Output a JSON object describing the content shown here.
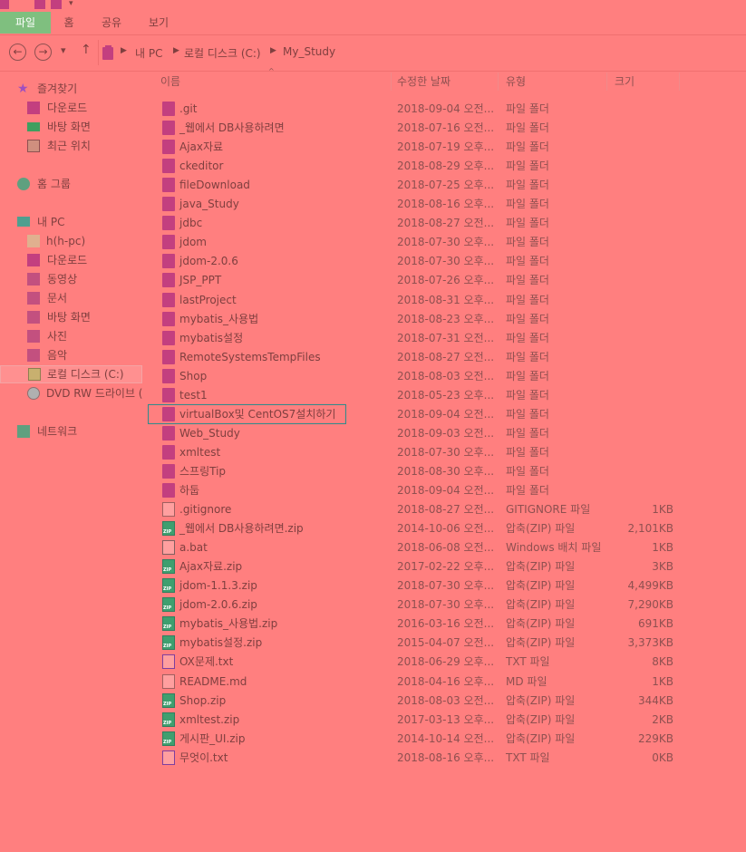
{
  "colors": {
    "background": "#ff7f7f",
    "text": "#7f3f3f",
    "active_tab_bg": "#7fbf7f",
    "folder_icon": "#c33f7f",
    "zip_icon": "#3f9f6f",
    "focus_border": "#2e8b8b"
  },
  "ribbon": {
    "tabs": [
      "파일",
      "홈",
      "공유",
      "보기"
    ]
  },
  "address": {
    "back": "←",
    "forward": "→",
    "recent": "▾",
    "up": "↑",
    "crumbs": [
      "내 PC",
      "로컬 디스크 (C:)",
      "My_Study"
    ]
  },
  "nav": {
    "items": [
      {
        "label": "즐겨찾기",
        "icon": "star-icon"
      },
      {
        "label": "다운로드",
        "icon": "download-folder-icon"
      },
      {
        "label": "바탕 화면",
        "icon": "desktop-icon"
      },
      {
        "label": "최근 위치",
        "icon": "recent-places-icon"
      },
      {
        "label": "홈 그룹",
        "icon": "homegroup-icon"
      },
      {
        "label": "내 PC",
        "icon": "computer-icon"
      },
      {
        "label": "h(h-pc)",
        "icon": "user-folder-icon"
      },
      {
        "label": "다운로드",
        "icon": "download-folder-icon"
      },
      {
        "label": "동영상",
        "icon": "videos-folder-icon"
      },
      {
        "label": "문서",
        "icon": "documents-folder-icon"
      },
      {
        "label": "바탕 화면",
        "icon": "desktop-folder-icon"
      },
      {
        "label": "사진",
        "icon": "pictures-folder-icon"
      },
      {
        "label": "음악",
        "icon": "music-folder-icon"
      },
      {
        "label": "로컬 디스크 (C:)",
        "icon": "local-disk-icon"
      },
      {
        "label": "DVD RW 드라이브 (",
        "icon": "dvd-drive-icon"
      },
      {
        "label": "네트워크",
        "icon": "network-icon"
      }
    ]
  },
  "columns": {
    "name": "이름",
    "date": "수정한 날짜",
    "type": "유형",
    "size": "크기",
    "sort_indicator": "^"
  },
  "files": [
    {
      "name": ".git",
      "date": "2018-09-04 오전...",
      "type": "파일 폴더",
      "size": "",
      "icon": "folder"
    },
    {
      "name": "_웹에서 DB사용하려면",
      "date": "2018-07-16 오전...",
      "type": "파일 폴더",
      "size": "",
      "icon": "folder"
    },
    {
      "name": "Ajax자료",
      "date": "2018-07-19 오후...",
      "type": "파일 폴더",
      "size": "",
      "icon": "folder"
    },
    {
      "name": "ckeditor",
      "date": "2018-08-29 오후...",
      "type": "파일 폴더",
      "size": "",
      "icon": "folder"
    },
    {
      "name": "fileDownload",
      "date": "2018-07-25 오후...",
      "type": "파일 폴더",
      "size": "",
      "icon": "folder"
    },
    {
      "name": "java_Study",
      "date": "2018-08-16 오후...",
      "type": "파일 폴더",
      "size": "",
      "icon": "folder"
    },
    {
      "name": "jdbc",
      "date": "2018-08-27 오전...",
      "type": "파일 폴더",
      "size": "",
      "icon": "folder"
    },
    {
      "name": "jdom",
      "date": "2018-07-30 오후...",
      "type": "파일 폴더",
      "size": "",
      "icon": "folder"
    },
    {
      "name": "jdom-2.0.6",
      "date": "2018-07-30 오후...",
      "type": "파일 폴더",
      "size": "",
      "icon": "folder"
    },
    {
      "name": "JSP_PPT",
      "date": "2018-07-26 오후...",
      "type": "파일 폴더",
      "size": "",
      "icon": "folder"
    },
    {
      "name": "lastProject",
      "date": "2018-08-31 오후...",
      "type": "파일 폴더",
      "size": "",
      "icon": "folder"
    },
    {
      "name": "mybatis_사용법",
      "date": "2018-08-23 오후...",
      "type": "파일 폴더",
      "size": "",
      "icon": "folder"
    },
    {
      "name": "mybatis설정",
      "date": "2018-07-31 오전...",
      "type": "파일 폴더",
      "size": "",
      "icon": "folder"
    },
    {
      "name": "RemoteSystemsTempFiles",
      "date": "2018-08-27 오전...",
      "type": "파일 폴더",
      "size": "",
      "icon": "folder"
    },
    {
      "name": "Shop",
      "date": "2018-08-03 오전...",
      "type": "파일 폴더",
      "size": "",
      "icon": "folder"
    },
    {
      "name": "test1",
      "date": "2018-05-23 오후...",
      "type": "파일 폴더",
      "size": "",
      "icon": "folder"
    },
    {
      "name": "virtualBox및 CentOS7설치하기",
      "date": "2018-09-04 오전...",
      "type": "파일 폴더",
      "size": "",
      "icon": "folder"
    },
    {
      "name": "Web_Study",
      "date": "2018-09-03 오전...",
      "type": "파일 폴더",
      "size": "",
      "icon": "folder"
    },
    {
      "name": "xmltest",
      "date": "2018-07-30 오후...",
      "type": "파일 폴더",
      "size": "",
      "icon": "folder"
    },
    {
      "name": "스프링Tip",
      "date": "2018-08-30 오후...",
      "type": "파일 폴더",
      "size": "",
      "icon": "folder"
    },
    {
      "name": "하둡",
      "date": "2018-09-04 오전...",
      "type": "파일 폴더",
      "size": "",
      "icon": "folder"
    },
    {
      "name": ".gitignore",
      "date": "2018-08-27 오전...",
      "type": "GITIGNORE 파일",
      "size": "1KB",
      "icon": "doc"
    },
    {
      "name": "_웹에서 DB사용하려면.zip",
      "date": "2014-10-06 오전...",
      "type": "압축(ZIP) 파일",
      "size": "2,101KB",
      "icon": "zip"
    },
    {
      "name": "a.bat",
      "date": "2018-06-08 오전...",
      "type": "Windows 배치 파일",
      "size": "1KB",
      "icon": "bat"
    },
    {
      "name": "Ajax자료.zip",
      "date": "2017-02-22 오후...",
      "type": "압축(ZIP) 파일",
      "size": "3KB",
      "icon": "zip"
    },
    {
      "name": "jdom-1.1.3.zip",
      "date": "2018-07-30 오후...",
      "type": "압축(ZIP) 파일",
      "size": "4,499KB",
      "icon": "zip"
    },
    {
      "name": "jdom-2.0.6.zip",
      "date": "2018-07-30 오후...",
      "type": "압축(ZIP) 파일",
      "size": "7,290KB",
      "icon": "zip"
    },
    {
      "name": "mybatis_사용법.zip",
      "date": "2016-03-16 오전...",
      "type": "압축(ZIP) 파일",
      "size": "691KB",
      "icon": "zip"
    },
    {
      "name": "mybatis설정.zip",
      "date": "2015-04-07 오전...",
      "type": "압축(ZIP) 파일",
      "size": "3,373KB",
      "icon": "zip"
    },
    {
      "name": "OX문제.txt",
      "date": "2018-06-29 오후...",
      "type": "TXT 파일",
      "size": "8KB",
      "icon": "txt"
    },
    {
      "name": "README.md",
      "date": "2018-04-16 오후...",
      "type": "MD 파일",
      "size": "1KB",
      "icon": "doc"
    },
    {
      "name": "Shop.zip",
      "date": "2018-08-03 오전...",
      "type": "압축(ZIP) 파일",
      "size": "344KB",
      "icon": "zip"
    },
    {
      "name": "xmltest.zip",
      "date": "2017-03-13 오후...",
      "type": "압축(ZIP) 파일",
      "size": "2KB",
      "icon": "zip"
    },
    {
      "name": "게시판_UI.zip",
      "date": "2014-10-14 오전...",
      "type": "압축(ZIP) 파일",
      "size": "229KB",
      "icon": "zip"
    },
    {
      "name": "무엇이.txt",
      "date": "2018-08-16 오후...",
      "type": "TXT 파일",
      "size": "0KB",
      "icon": "txt"
    }
  ]
}
